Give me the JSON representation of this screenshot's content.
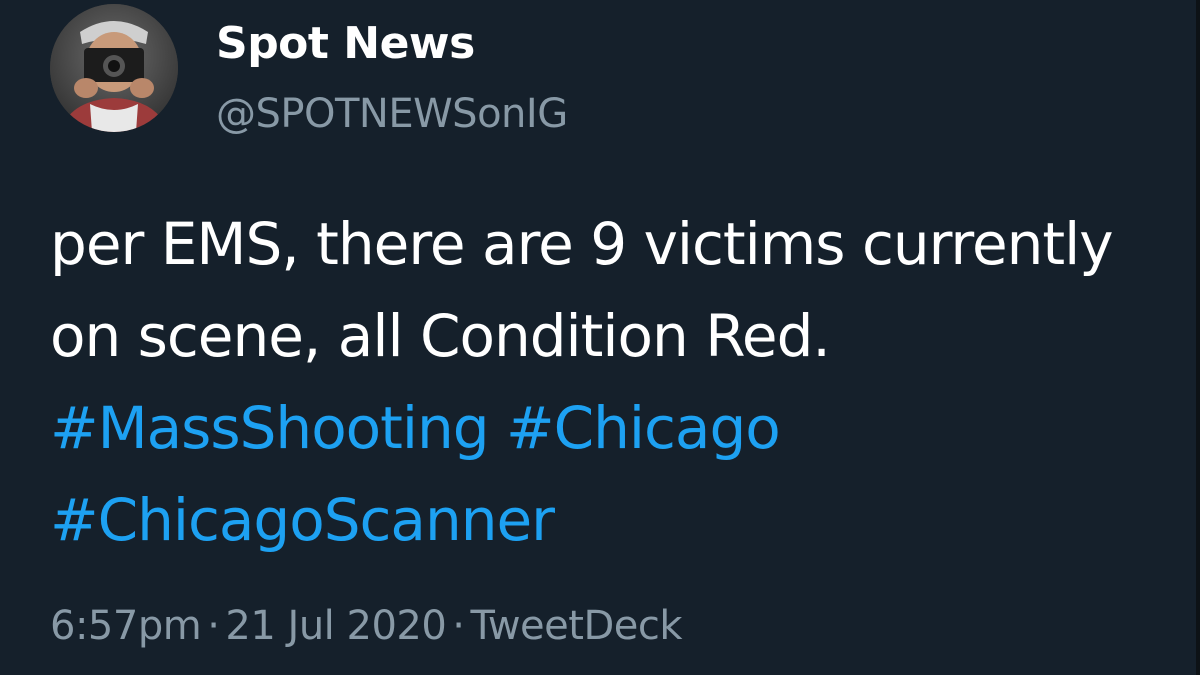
{
  "author": {
    "display_name": "Spot News",
    "handle": "@SPOTNEWSonIG",
    "avatar_icon": "photographer-avatar"
  },
  "tweet": {
    "text_parts": {
      "t1": "per EMS, there are 9 victims currently on scene, all Condition Red.",
      "h1": "#MassShooting",
      "h2": "#Chicago",
      "h3": "#ChicagoScanner"
    }
  },
  "meta": {
    "time": "6:57pm",
    "date": "21 Jul 2020",
    "separator": "·",
    "source": "TweetDeck"
  },
  "colors": {
    "background": "#15202b",
    "text": "#ffffff",
    "secondary": "#8899a6",
    "link": "#1da1f2"
  }
}
